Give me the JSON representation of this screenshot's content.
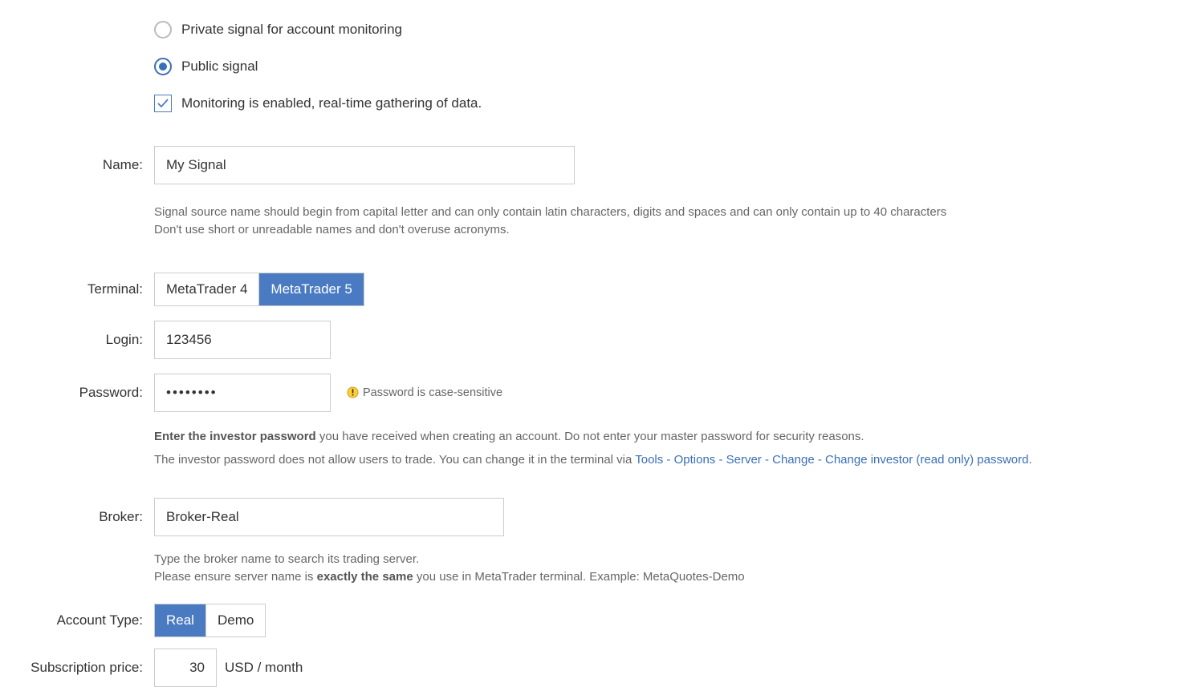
{
  "signalType": {
    "privateLabel": "Private signal for account monitoring",
    "publicLabel": "Public signal",
    "monitoringLabel": "Monitoring is enabled, real-time gathering of data."
  },
  "labels": {
    "name": "Name:",
    "terminal": "Terminal:",
    "login": "Login:",
    "password": "Password:",
    "broker": "Broker:",
    "accountType": "Account Type:",
    "subscriptionPrice": "Subscription price:"
  },
  "values": {
    "name": "My Signal",
    "login": "123456",
    "password": "••••••••",
    "broker": "Broker-Real",
    "price": "30"
  },
  "terminal": {
    "mt4": "MetaTrader 4",
    "mt5": "MetaTrader 5"
  },
  "accountType": {
    "real": "Real",
    "demo": "Demo"
  },
  "priceSuffix": "USD / month",
  "nameHelpLine1": "Signal source name should begin from capital letter and can only contain latin characters, digits and spaces and can only contain up to 40 characters",
  "nameHelpLine2": "Don't use short or unreadable names and don't overuse acronyms.",
  "passwordNote": "Password is case-sensitive",
  "passwordHelpBold": "Enter the investor password",
  "passwordHelpRest": " you have received when creating an account. Do not enter your master password for security reasons.",
  "passwordHelp2Lead": "The investor password does not allow users to trade. You can change it in the terminal via ",
  "passwordHelp2Link": "Tools - Options - Server - Change - Change investor (read only) password",
  "brokerHelpLine1": "Type the broker name to search its trading server.",
  "brokerHelpLine2a": "Please ensure server name is ",
  "brokerHelpLine2Bold": "exactly the same",
  "brokerHelpLine2b": " you use in MetaTrader terminal. Example: MetaQuotes-Demo"
}
